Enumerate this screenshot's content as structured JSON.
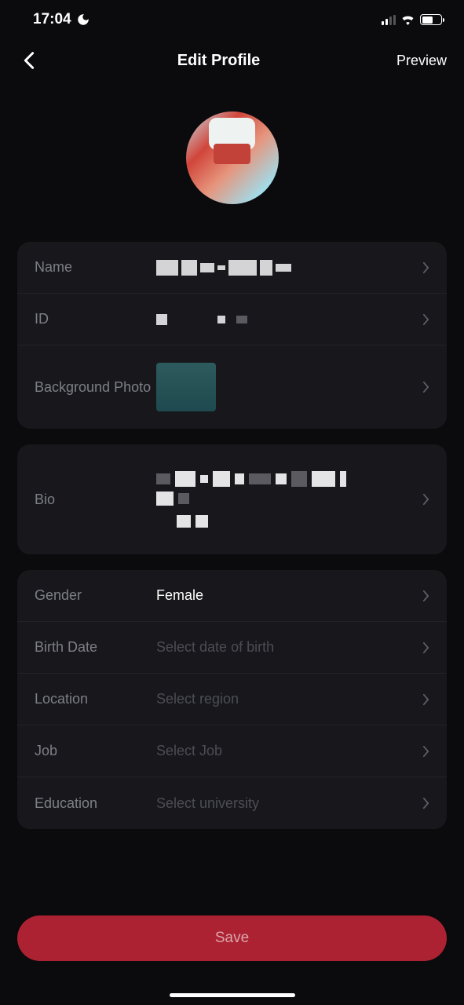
{
  "statusBar": {
    "time": "17:04"
  },
  "header": {
    "title": "Edit Profile",
    "preview_label": "Preview"
  },
  "fields": {
    "name": {
      "label": "Name",
      "value": ""
    },
    "id": {
      "label": "ID",
      "value": ""
    },
    "backgroundPhoto": {
      "label": "Background Photo"
    },
    "bio": {
      "label": "Bio",
      "value": ""
    },
    "gender": {
      "label": "Gender",
      "value": "Female"
    },
    "birthDate": {
      "label": "Birth Date",
      "placeholder": "Select date of birth"
    },
    "location": {
      "label": "Location",
      "placeholder": "Select region"
    },
    "job": {
      "label": "Job",
      "placeholder": "Select Job"
    },
    "education": {
      "label": "Education",
      "placeholder": "Select university"
    }
  },
  "actions": {
    "save_label": "Save"
  }
}
